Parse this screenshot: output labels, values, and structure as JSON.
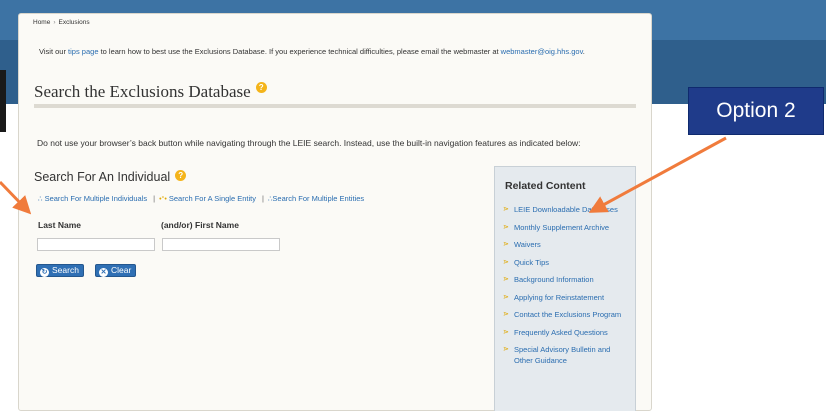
{
  "breadcrumb": {
    "home": "Home",
    "separator": "›",
    "current": "Exclusions"
  },
  "notice": {
    "pre": "Visit our ",
    "tips_link": "tips page",
    "mid": " to learn how to best use the Exclusions Database. If you experience technical difficulties, please email the webmaster at ",
    "email": "webmaster@oig.hhs.gov",
    "end": "."
  },
  "page_title": "Search the Exclusions Database",
  "instructions": "Do not use your browser’s back button while navigating through the LEIE search. Instead, use the built-in navigation features as indicated below:",
  "form": {
    "heading": "Search For An Individual",
    "links": {
      "multiple_individuals": "Search For Multiple Individuals",
      "single_entity": "Search For A Single Entity",
      "multiple_entities": "Search For Multiple Entities",
      "separator": "|"
    },
    "last_name_label": "Last Name",
    "first_name_label": "(and/or) First Name",
    "last_name_value": "",
    "first_name_value": "",
    "search_label": "Search",
    "clear_label": "Clear"
  },
  "related": {
    "title": "Related Content",
    "items": [
      "LEIE Downloadable Databases",
      "Monthly Supplement Archive",
      "Waivers",
      "Quick Tips",
      "Background Information",
      "Applying for Reinstatement",
      "Contact the Exclusions Program",
      "Frequently Asked Questions",
      "Special Advisory Bulletin and Other Guidance"
    ]
  },
  "callout": {
    "label": "Option 2"
  },
  "colors": {
    "header_band": "#2f5f8c",
    "link": "#2a6db0",
    "callout": "#1f3b8a",
    "arrow": "#f07b3c",
    "help_icon": "#f4b41a"
  },
  "icons": {
    "help": "question-circle-icon",
    "search": "refresh-icon",
    "clear": "clear-icon",
    "bullet": "triple-chevron-icon"
  }
}
